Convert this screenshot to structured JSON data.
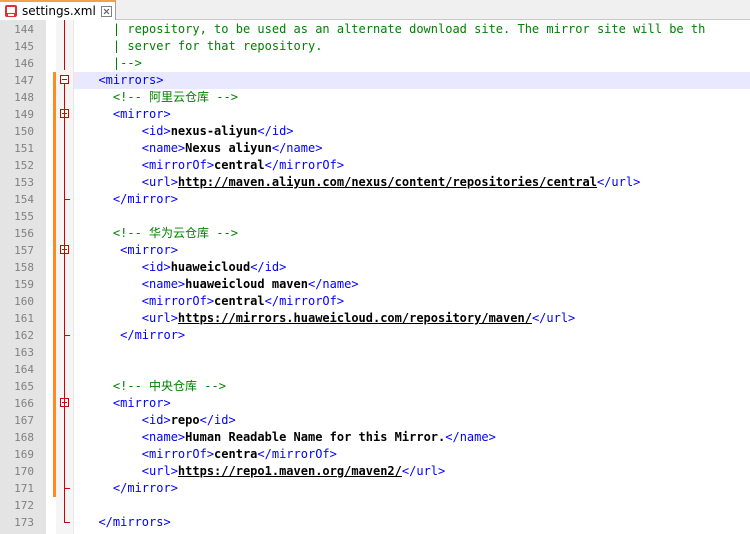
{
  "tab": {
    "title": "settings.xml"
  },
  "lines": [
    {
      "num": "144",
      "parts": [
        {
          "c": "cmt",
          "t": "    | repository, to be used as an alternate download site. The mirror site will be th"
        }
      ]
    },
    {
      "num": "145",
      "parts": [
        {
          "c": "cmt",
          "t": "    | server for that repository."
        }
      ]
    },
    {
      "num": "146",
      "parts": [
        {
          "c": "cmt",
          "t": "    |-->"
        }
      ]
    },
    {
      "num": "147",
      "parts": [
        {
          "c": "tag",
          "t": "  <mirrors>"
        }
      ]
    },
    {
      "num": "148",
      "parts": [
        {
          "c": "cmt",
          "t": "    <!-- 阿里云仓库 -->"
        }
      ]
    },
    {
      "num": "149",
      "parts": [
        {
          "c": "tag",
          "t": "    <mirror>"
        }
      ]
    },
    {
      "num": "150",
      "parts": [
        {
          "c": "tag",
          "t": "        <id>"
        },
        {
          "c": "txt",
          "t": "nexus-aliyun"
        },
        {
          "c": "tag",
          "t": "</id>"
        }
      ]
    },
    {
      "num": "151",
      "parts": [
        {
          "c": "tag",
          "t": "        <name>"
        },
        {
          "c": "txt",
          "t": "Nexus aliyun"
        },
        {
          "c": "tag",
          "t": "</name>"
        }
      ]
    },
    {
      "num": "152",
      "parts": [
        {
          "c": "tag",
          "t": "        <mirrorOf>"
        },
        {
          "c": "txt",
          "t": "central"
        },
        {
          "c": "tag",
          "t": "</mirrorOf>"
        }
      ]
    },
    {
      "num": "153",
      "parts": [
        {
          "c": "tag",
          "t": "        <url>"
        },
        {
          "c": "url",
          "t": "http://maven.aliyun.com/nexus/content/repositories/central"
        },
        {
          "c": "tag",
          "t": "</url>"
        }
      ]
    },
    {
      "num": "154",
      "parts": [
        {
          "c": "tag",
          "t": "    </mirror>"
        }
      ]
    },
    {
      "num": "155",
      "parts": [
        {
          "c": "txt",
          "t": ""
        }
      ]
    },
    {
      "num": "156",
      "parts": [
        {
          "c": "cmt",
          "t": "    <!-- 华为云仓库 -->"
        }
      ]
    },
    {
      "num": "157",
      "parts": [
        {
          "c": "tag",
          "t": "     <mirror>"
        }
      ]
    },
    {
      "num": "158",
      "parts": [
        {
          "c": "tag",
          "t": "        <id>"
        },
        {
          "c": "txt",
          "t": "huaweicloud"
        },
        {
          "c": "tag",
          "t": "</id>"
        }
      ]
    },
    {
      "num": "159",
      "parts": [
        {
          "c": "tag",
          "t": "        <name>"
        },
        {
          "c": "txt",
          "t": "huaweicloud maven"
        },
        {
          "c": "tag",
          "t": "</name>"
        }
      ]
    },
    {
      "num": "160",
      "parts": [
        {
          "c": "tag",
          "t": "        <mirrorOf>"
        },
        {
          "c": "txt",
          "t": "central"
        },
        {
          "c": "tag",
          "t": "</mirrorOf>"
        }
      ]
    },
    {
      "num": "161",
      "parts": [
        {
          "c": "tag",
          "t": "        <url>"
        },
        {
          "c": "url",
          "t": "https://mirrors.huaweicloud.com/repository/maven/"
        },
        {
          "c": "tag",
          "t": "</url>"
        }
      ]
    },
    {
      "num": "162",
      "parts": [
        {
          "c": "tag",
          "t": "     </mirror>"
        }
      ]
    },
    {
      "num": "163",
      "parts": [
        {
          "c": "txt",
          "t": ""
        }
      ]
    },
    {
      "num": "164",
      "parts": [
        {
          "c": "txt",
          "t": ""
        }
      ]
    },
    {
      "num": "165",
      "parts": [
        {
          "c": "cmt",
          "t": "    <!-- 中央仓库 -->"
        }
      ]
    },
    {
      "num": "166",
      "parts": [
        {
          "c": "tag",
          "t": "    <mirror>"
        }
      ]
    },
    {
      "num": "167",
      "parts": [
        {
          "c": "tag",
          "t": "        <id>"
        },
        {
          "c": "txt",
          "t": "repo"
        },
        {
          "c": "tag",
          "t": "</id>"
        }
      ]
    },
    {
      "num": "168",
      "parts": [
        {
          "c": "tag",
          "t": "        <name>"
        },
        {
          "c": "txt",
          "t": "Human Readable Name for this Mirror."
        },
        {
          "c": "tag",
          "t": "</name>"
        }
      ]
    },
    {
      "num": "169",
      "parts": [
        {
          "c": "tag",
          "t": "        <mirrorOf>"
        },
        {
          "c": "txt",
          "t": "centra"
        },
        {
          "c": "tag",
          "t": "</mirrorOf>"
        }
      ]
    },
    {
      "num": "170",
      "parts": [
        {
          "c": "tag",
          "t": "        <url>"
        },
        {
          "c": "url",
          "t": "https://repo1.maven.org/maven2/"
        },
        {
          "c": "tag",
          "t": "</url>"
        }
      ]
    },
    {
      "num": "171",
      "parts": [
        {
          "c": "tag",
          "t": "    </mirror>"
        }
      ]
    },
    {
      "num": "172",
      "parts": [
        {
          "c": "txt",
          "t": ""
        }
      ]
    },
    {
      "num": "173",
      "parts": [
        {
          "c": "tag",
          "t": "  </mirrors>"
        }
      ]
    }
  ]
}
